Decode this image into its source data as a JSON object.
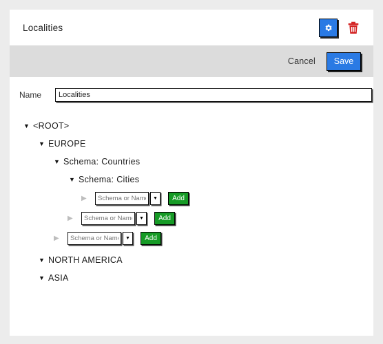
{
  "header": {
    "title": "Localities",
    "gear_icon": "gear-icon",
    "trash_icon": "trash-icon",
    "accent_color": "#2a7ae4",
    "danger_color": "#d32020"
  },
  "toolbar": {
    "cancel_label": "Cancel",
    "save_label": "Save"
  },
  "form": {
    "name_label": "Name",
    "name_value": "Localities",
    "name_placeholder": ""
  },
  "tree": {
    "nodes": [
      {
        "label": "<ROOT>",
        "caret": "▼",
        "indent": 20,
        "expanded": true
      },
      {
        "label": "EUROPE",
        "caret": "▼",
        "indent": 42,
        "expanded": true
      },
      {
        "label": "Schema: Countries",
        "caret": "▼",
        "indent": 64,
        "expanded": true
      },
      {
        "label": "Schema: Cities",
        "caret": "▼",
        "indent": 86,
        "expanded": true
      }
    ],
    "trailing_nodes": [
      {
        "label": "NORTH AMERICA",
        "caret": "▼",
        "indent": 42,
        "expanded": true
      },
      {
        "label": "ASIA",
        "caret": "▼",
        "indent": 42,
        "expanded": true
      }
    ]
  },
  "combo_rows": [
    {
      "caret": "▶",
      "indent": 104,
      "placeholder": "Schema or Name",
      "value": "",
      "arrow": "▼",
      "add_label": "Add"
    },
    {
      "caret": "▶",
      "indent": 84,
      "placeholder": "Schema or Name",
      "value": "",
      "arrow": "▼",
      "add_label": "Add"
    },
    {
      "caret": "▶",
      "indent": 64,
      "placeholder": "Schema or Name",
      "value": "",
      "arrow": "▼",
      "add_label": "Add"
    }
  ],
  "colors": {
    "page_background": "#ececec",
    "card_background": "#ffffff",
    "toolbar_background": "#dcdcdc",
    "add_green": "#169b26"
  }
}
